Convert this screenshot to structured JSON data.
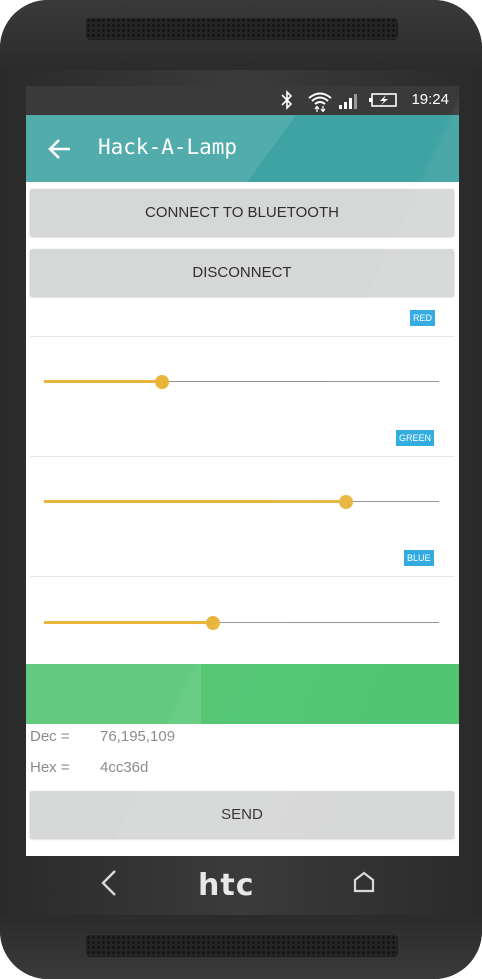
{
  "device": {
    "brand": "htc"
  },
  "statusbar": {
    "time": "19:24",
    "icons": [
      "bluetooth-icon",
      "wifi-icon",
      "signal-icon",
      "battery-charging-icon"
    ]
  },
  "appbar": {
    "title": "Hack-A-Lamp",
    "back_icon": "arrow-left-icon",
    "color": "#3fa3a3"
  },
  "buttons": {
    "connect": "CONNECT TO BLUETOOTH",
    "disconnect": "DISCONNECT",
    "send": "SEND"
  },
  "sliders": [
    {
      "label": "RED",
      "value": 76,
      "max": 255
    },
    {
      "label": "GREEN",
      "value": 195,
      "max": 255
    },
    {
      "label": "BLUE",
      "value": 109,
      "max": 255
    }
  ],
  "preview": {
    "color": "#4cc36d"
  },
  "readout": {
    "dec_label": "Dec =",
    "dec_value": "76,195,109",
    "hex_label": "Hex =",
    "hex_value": "4cc36d"
  },
  "accent_color": "#e8b43a",
  "chip_color": "#29a8df",
  "navbar": {
    "back_icon": "nav-back-icon",
    "home_icon": "nav-home-icon"
  }
}
